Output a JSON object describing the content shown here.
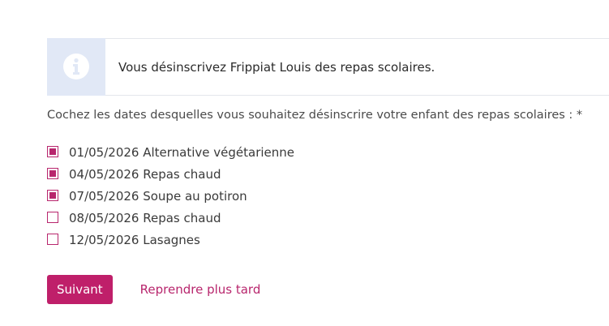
{
  "info": {
    "icon": "info-icon",
    "message": "Vous désinscrivez Frippiat Louis des repas scolaires."
  },
  "form": {
    "question": "Cochez les dates desquelles vous souhaitez désinscrire votre enfant des repas scolaires : *",
    "options": [
      {
        "label": "01/05/2026 Alternative végétarienne",
        "checked": true
      },
      {
        "label": "04/05/2026 Repas chaud",
        "checked": true
      },
      {
        "label": "07/05/2026 Soupe au potiron",
        "checked": true
      },
      {
        "label": "08/05/2026 Repas chaud",
        "checked": false
      },
      {
        "label": "12/05/2026 Lasagnes",
        "checked": false
      }
    ]
  },
  "actions": {
    "next_label": "Suivant",
    "later_label": "Reprendre plus tard"
  },
  "colors": {
    "accent": "#bf1f6a",
    "info_bg": "#e1e8f6"
  }
}
